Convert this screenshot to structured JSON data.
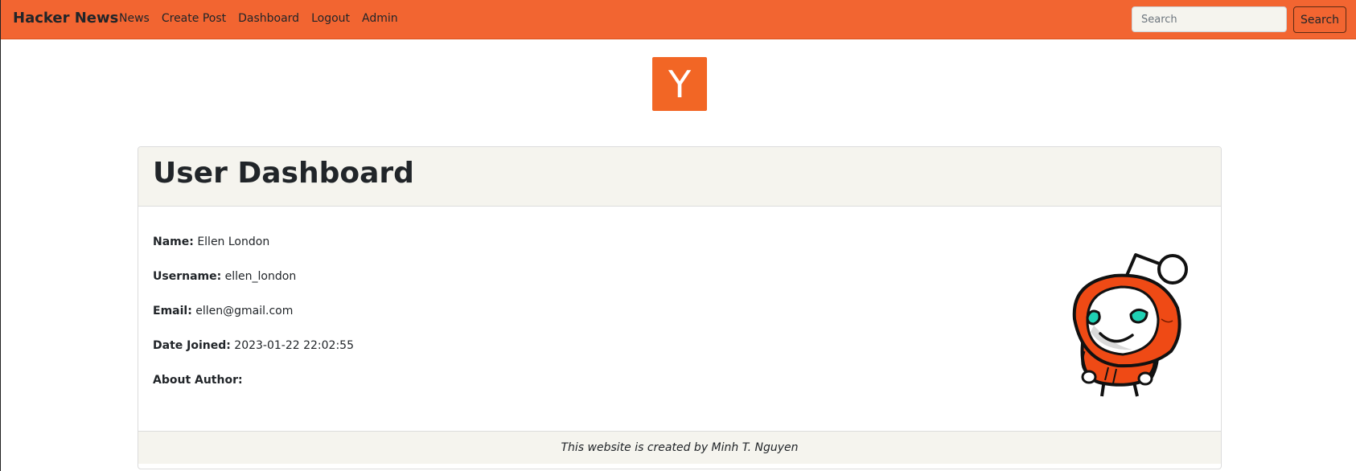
{
  "navbar": {
    "brand": "Hacker News",
    "links": [
      "News",
      "Create Post",
      "Dashboard",
      "Logout",
      "Admin"
    ],
    "search_placeholder": "Search",
    "search_button": "Search"
  },
  "logo": {
    "letter": "Y",
    "icon": "y-combinator-logo-icon"
  },
  "dashboard": {
    "title": "User Dashboard",
    "fields": [
      {
        "label": "Name:",
        "value": "Ellen London"
      },
      {
        "label": "Username:",
        "value": "ellen_london"
      },
      {
        "label": "Email:",
        "value": "ellen@gmail.com"
      },
      {
        "label": "Date Joined:",
        "value": "2023-01-22 22:02:55"
      },
      {
        "label": "About Author:",
        "value": ""
      }
    ],
    "avatar_icon": "reddit-snoo-mascot-icon"
  },
  "footer": {
    "text": "This website is created by Minh T. Nguyen"
  },
  "colors": {
    "brand_orange": "#f26531",
    "panel_bg": "#f5f4ee"
  }
}
